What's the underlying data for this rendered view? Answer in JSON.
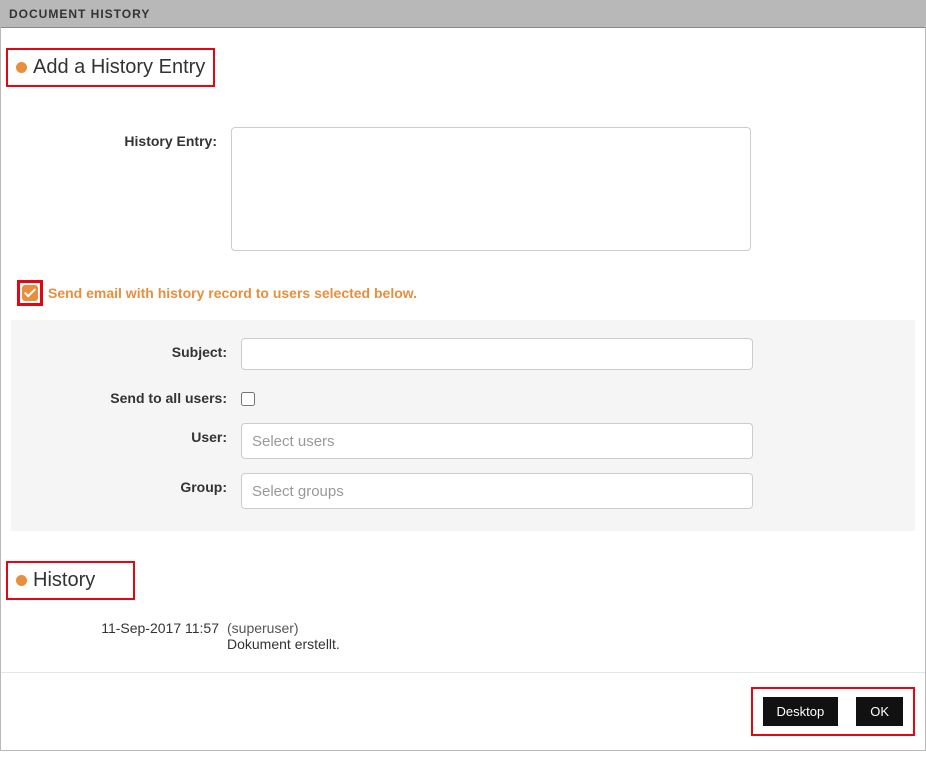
{
  "topbar": {
    "title": "DOCUMENT HISTORY"
  },
  "sections": {
    "add_heading": "Add a History Entry",
    "history_heading": "History"
  },
  "form": {
    "history_entry_label": "History Entry:",
    "history_entry_value": "",
    "email_checkbox_label": "Send email with history record to users selected below.",
    "email_checkbox_checked": true,
    "subject_label": "Subject:",
    "subject_value": "",
    "send_all_label": "Send to all users:",
    "send_all_checked": false,
    "user_label": "User:",
    "user_placeholder": "Select users",
    "group_label": "Group:",
    "group_placeholder": "Select groups"
  },
  "history": {
    "entries": [
      {
        "date": "11-Sep-2017 11:57",
        "user": "(superuser)",
        "message": "Dokument erstellt."
      }
    ]
  },
  "footer": {
    "desktop_label": "Desktop",
    "ok_label": "OK"
  }
}
